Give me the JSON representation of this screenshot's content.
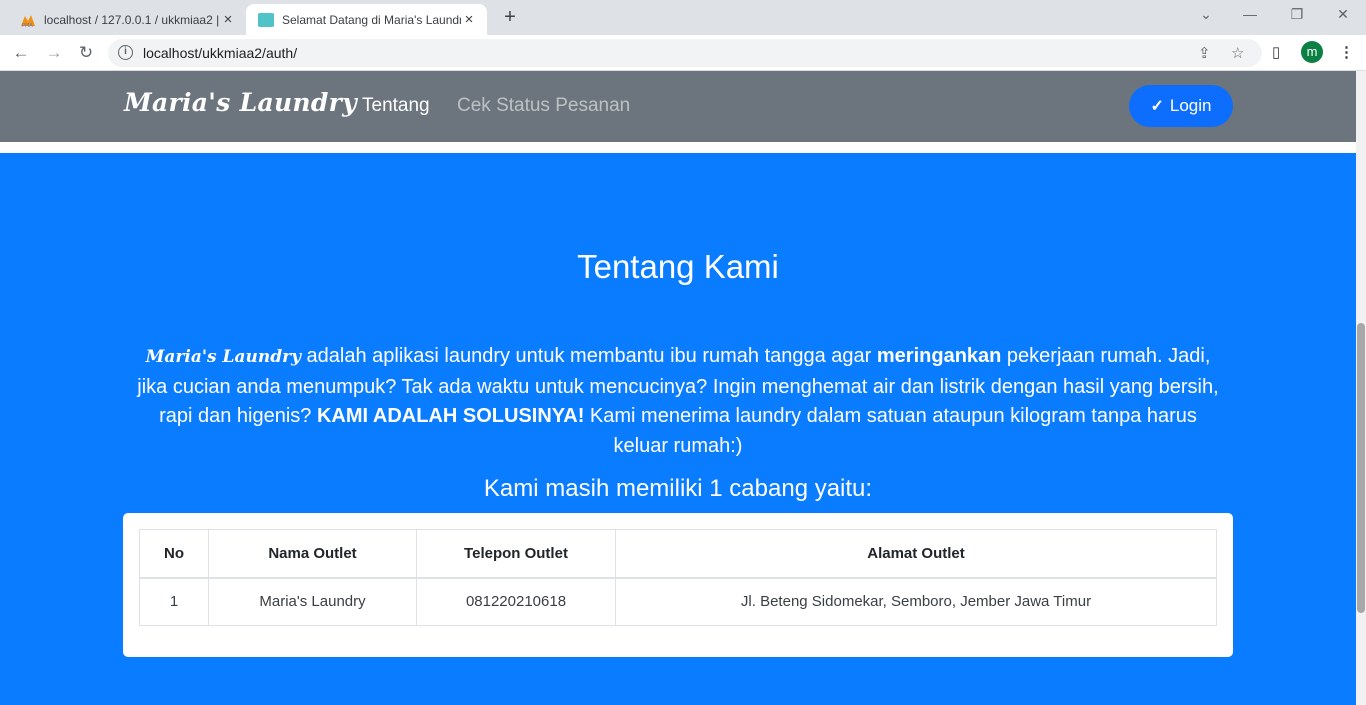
{
  "browser": {
    "tabs": [
      {
        "title": "localhost / 127.0.0.1 / ukkmiaa2 |",
        "active": false
      },
      {
        "title": "Selamat Datang di Maria's Laundry",
        "active": true
      }
    ],
    "address": "localhost/ukkmiaa2/auth/",
    "profile_initial": "m"
  },
  "icons": {
    "close": "×",
    "new_tab": "+",
    "back": "←",
    "forward": "→",
    "reload": "↻",
    "info": "i",
    "share": "⇪",
    "star": "☆",
    "side_panel": "▯",
    "menu": "⋮",
    "minimize": "—",
    "restore": "❐",
    "win_close": "✕",
    "tab_search": "⌄",
    "check": "✓"
  },
  "navbar": {
    "brand": "Maria's Laundry",
    "links": [
      "Tentang",
      "Cek Status Pesanan"
    ],
    "login_label": "Login"
  },
  "about": {
    "title": "Tentang Kami",
    "brand_inline": "Maria's Laundry",
    "text_1": " adalah aplikasi laundry untuk membantu ibu rumah tangga agar ",
    "bold_1": "meringankan",
    "text_2": " pekerjaan rumah. Jadi, jika cucian anda menumpuk? Tak ada waktu untuk mencucinya? Ingin menghemat air dan listrik dengan hasil yang bersih, rapi dan higenis? ",
    "bold_2": "KAMI ADALAH SOLUSINYA!",
    "text_3": " Kami menerima laundry dalam satuan ataupun kilogram tanpa harus keluar rumah:)",
    "branches_title": "Kami masih memiliki 1 cabang yaitu:"
  },
  "table": {
    "headers": [
      "No",
      "Nama Outlet",
      "Telepon Outlet",
      "Alamat Outlet"
    ],
    "rows": [
      [
        "1",
        "Maria's Laundry",
        "081220210618",
        "Jl. Beteng Sidomekar, Semboro, Jember Jawa Timur"
      ]
    ]
  },
  "colors": {
    "navbar": "#6c757d",
    "hero": "#0a7cff",
    "login_button": "#0d6efd"
  }
}
